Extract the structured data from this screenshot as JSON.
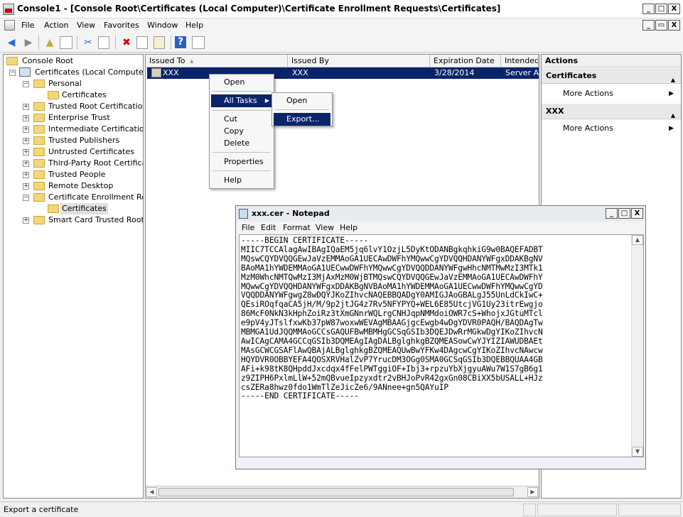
{
  "window": {
    "title": "Console1 - [Console Root\\Certificates (Local Computer)\\Certificate Enrollment Requests\\Certificates]",
    "min": "_",
    "max": "□",
    "close": "X",
    "sub_min": "_",
    "sub_max": "▭",
    "sub_close": "X"
  },
  "menu": {
    "file": "File",
    "action": "Action",
    "view": "View",
    "favorites": "Favorites",
    "window": "Window",
    "help": "Help"
  },
  "toolbar": {
    "back": "◀",
    "forward": "▶",
    "up": "▲",
    "cut": "✂",
    "delete": "✖",
    "help": "?"
  },
  "tree": {
    "root": "Console Root",
    "certs_local": "Certificates (Local Computer)",
    "personal": "Personal",
    "personal_certs": "Certificates",
    "trusted_root": "Trusted Root Certification A",
    "enterprise_trust": "Enterprise Trust",
    "intermediate": "Intermediate Certification A",
    "trusted_publishers": "Trusted Publishers",
    "untrusted": "Untrusted Certificates",
    "third_party": "Third-Party Root Certificatio",
    "trusted_people": "Trusted People",
    "remote_desktop": "Remote Desktop",
    "enrollment": "Certificate Enrollment Requ",
    "enrollment_certs": "Certificates",
    "smart_card": "Smart Card Trusted Roots",
    "plus": "+",
    "minus": "−"
  },
  "list": {
    "columns": {
      "issued_to": "Issued To",
      "issued_by": "Issued By",
      "expiration": "Expiration Date",
      "intended": "Intended"
    },
    "sort_glyph": "▲",
    "row": {
      "issued_to": "XXX",
      "issued_by": "XXX",
      "expiration": "3/28/2014",
      "intended": "Server Au"
    }
  },
  "actions": {
    "title": "Actions",
    "section1": "Certificates",
    "section2": "XXX",
    "more1": "More Actions",
    "more2": "More Actions"
  },
  "context_menu": {
    "open": "Open",
    "all_tasks": "All Tasks",
    "cut": "Cut",
    "copy": "Copy",
    "delete": "Delete",
    "properties": "Properties",
    "help": "Help"
  },
  "submenu": {
    "open": "Open",
    "export": "Export..."
  },
  "status": {
    "text": "Export a certificate"
  },
  "notepad": {
    "title": "xxx.cer - Notepad",
    "menu": {
      "file": "File",
      "edit": "Edit",
      "format": "Format",
      "view": "View",
      "help": "Help"
    },
    "lines": [
      "-----BEGIN CERTIFICATE-----",
      "MIIC7TCCAlagAwIBAgIQaEM5jq6lvY1OzjL5DyKtODANBgkqhkiG9w0BAQEFADBT",
      "MQswCQYDVQQGEwJaVzEMMAoGA1UECAwDWFhYMQwwCgYDVQQHDANYWFgxDDAKBgNV",
      "BAoMA1hYWDEMMAoGA1UECwwDWFhYMQwwCgYDVQQDDANYWFgwHhcNMTMwMzI3MTk1",
      "MzM0WhcNMTQwMzI3MjAxMzM0WjBTMQswCQYDVQQGEwJaVzEMMAoGA1UECAwDWFhY",
      "MQwwCgYDVQQHDANYWFgxDDAKBgNVBAoMA1hYWDEMMAoGA1UECwwDWFhYMQwwCgYD",
      "VQQDDANYWFgwgZ8wDQYJKoZIhvcNAQEBBQADgY0AMIGJAoGBALgJ55UnLdCkIwC+",
      "QEsiROqfqaCA5jH/M/9p2jtJG4z7Rv5NFYPYQ+WEL6E85UtcjVG1Uy23itrEwgjo",
      "86McF0NkN3kHphZoiRz3tXmGNnrWQLrgCNHJqpNMMdoiOWR7cS+WhojxJGtuMTcl",
      "e9pV4yJTslfxwKb37pW87woxwWEVAgMBAAGjgcEwgb4wDgYDVR0PAQH/BAQDAgTw",
      "MBMGA1UdJQQMMAoGCCsGAQUFBwMBMHgGCSqGSIb3DQEJDwRrMGkwDgYIKoZIhvcN",
      "AwICAgCAMA4GCCqGSIb3DQMEAgIAgDALBglghkgBZQMEASowCwYJYIZIAWUDBAEt",
      "MAsGCWCGSAFlAwQBAjALBglghkgBZQMEAQUwBwYFKw4DAgcwCgYIKoZIhvcNAwcw",
      "HQYDVR0OBBYEFA4QOSXRVHalZvP7YrucDM3OGg0SMA0GCSqGSIb3DQEBBQUAA4GB",
      "AFi+k98tK8QHpddJxcdqx4fFelPWTggiOF+Ibj3+rpzuYbXjgyuAWu7W1S7gB6g1",
      "z9ZIPH6PxlmLlW+52mQBvueIpzyxdtr2vBHJoPvR42gxGn08CBiXX5bUSALL+HJz",
      "csZERa8hwz0fdo1WmTlZeJicZe6/9ANnee+gn5QAYuIP",
      "-----END CERTIFICATE-----"
    ]
  }
}
